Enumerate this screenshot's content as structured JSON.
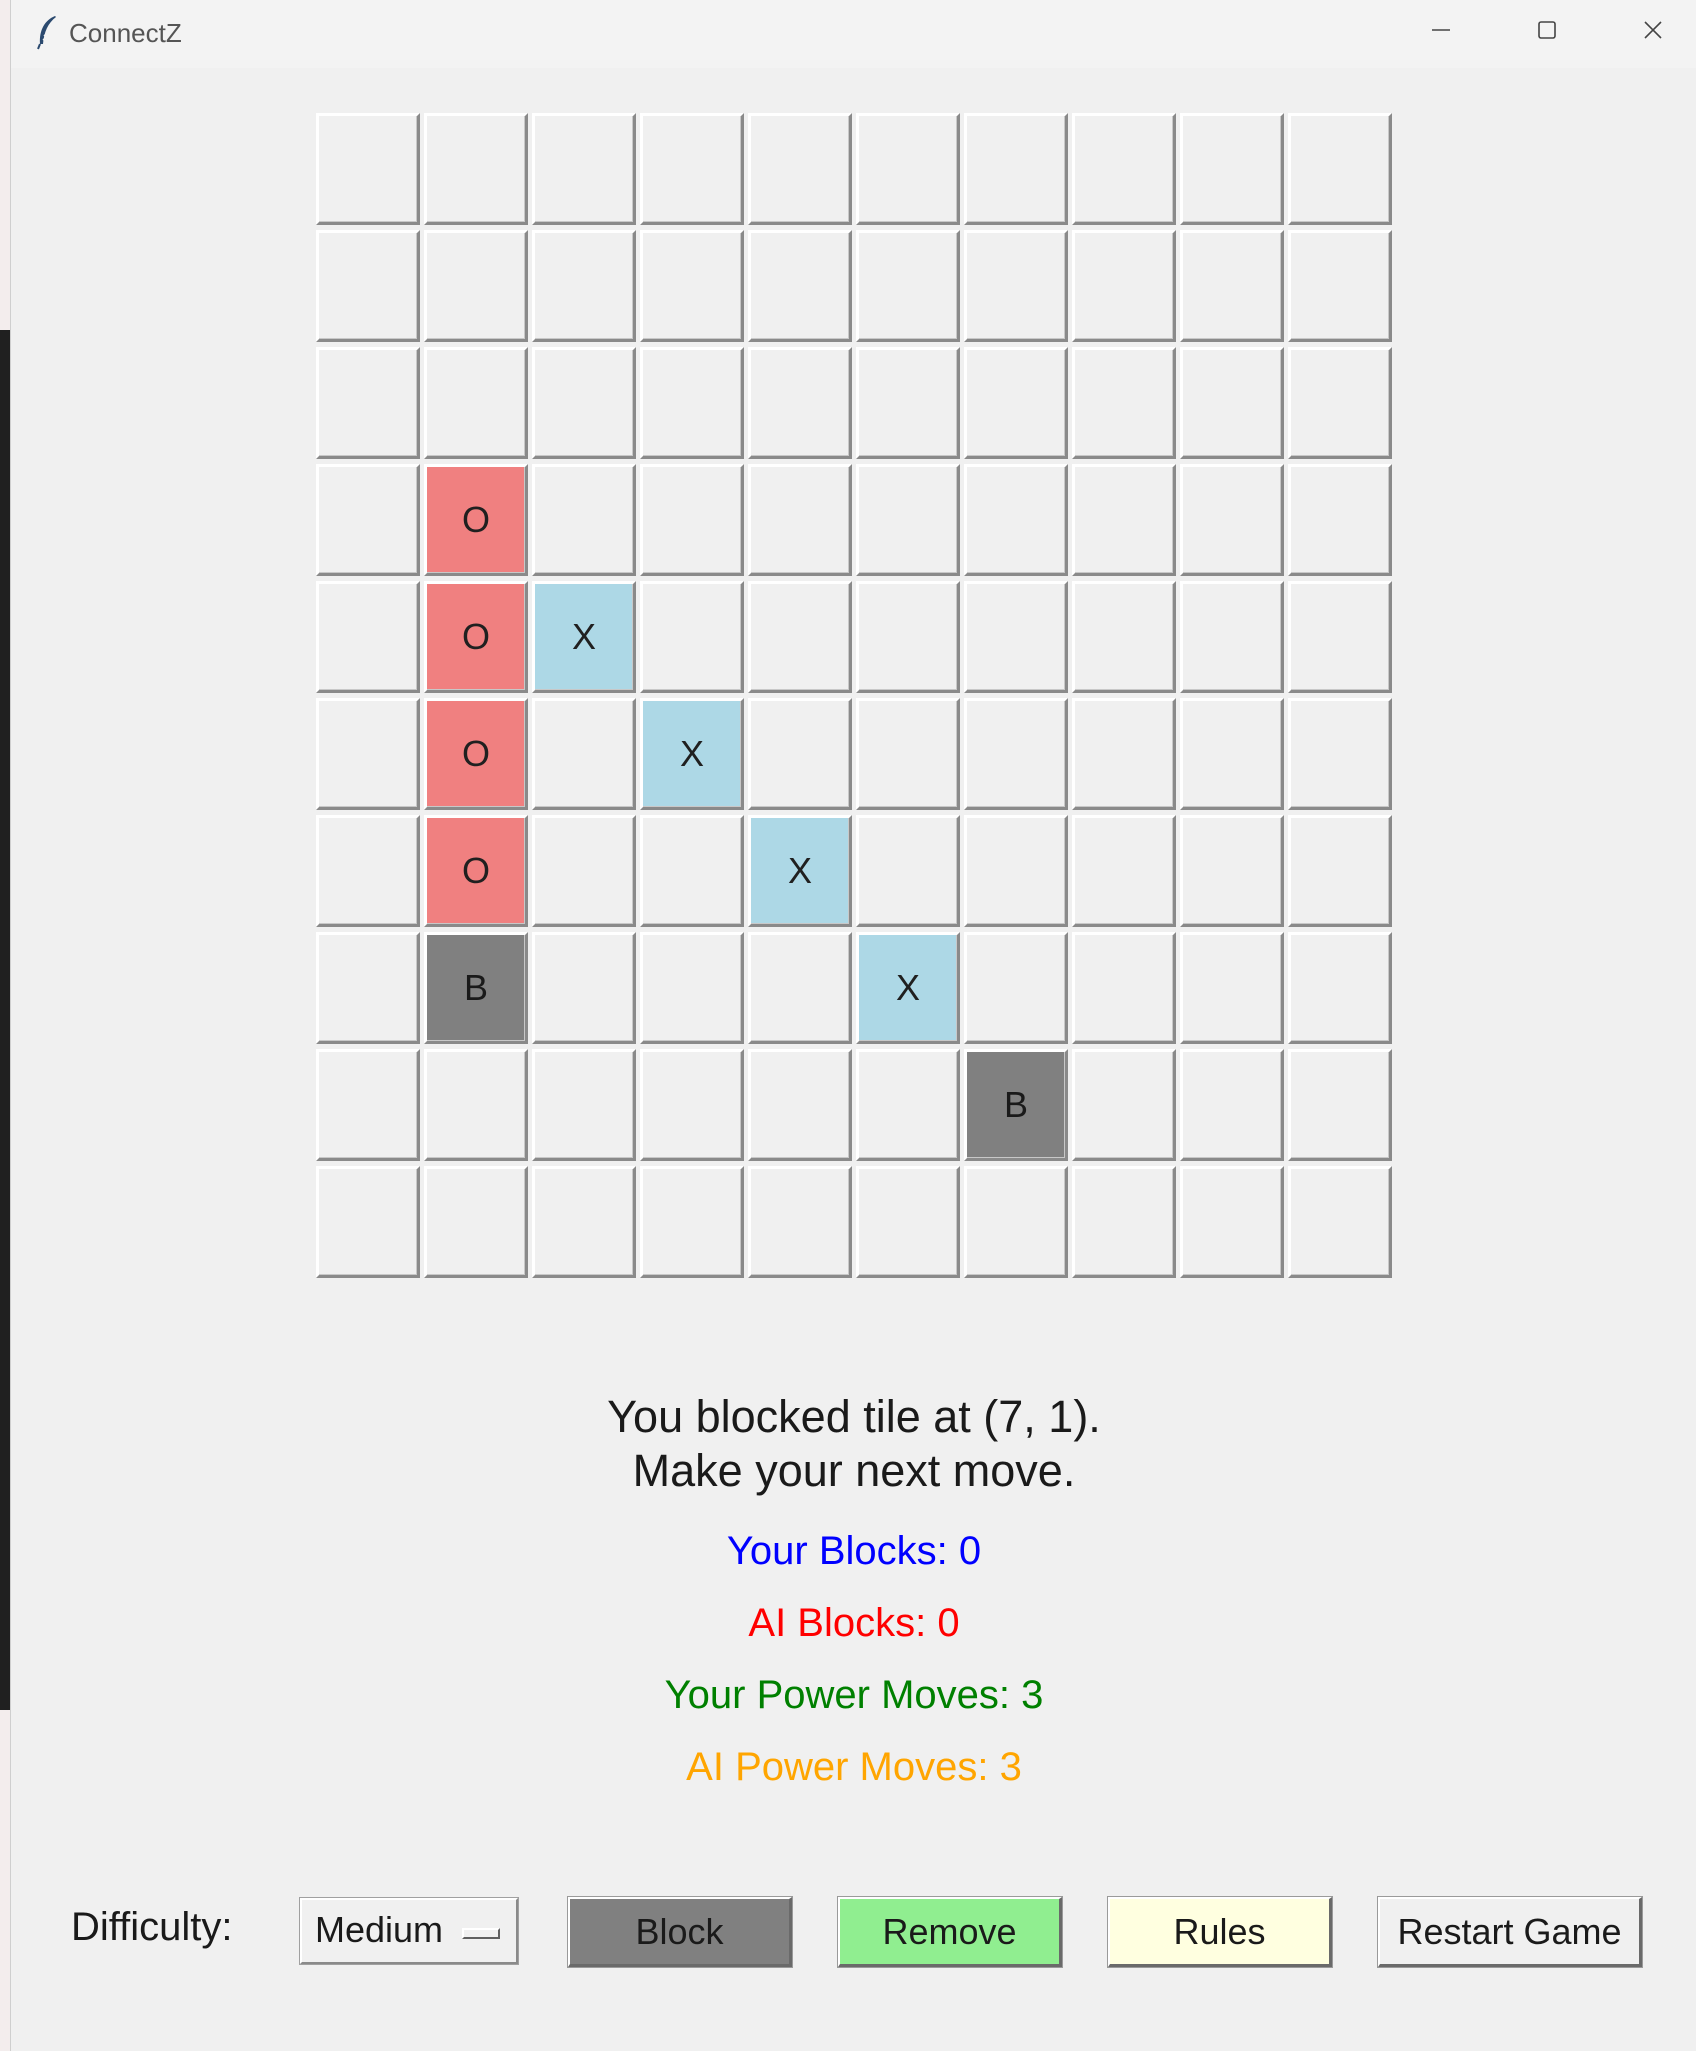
{
  "window": {
    "title": "ConnectZ",
    "icon": "feather-icon"
  },
  "board": {
    "rows": 10,
    "cols": 10,
    "cells": [
      [
        "",
        "",
        "",
        "",
        "",
        "",
        "",
        "",
        "",
        ""
      ],
      [
        "",
        "",
        "",
        "",
        "",
        "",
        "",
        "",
        "",
        ""
      ],
      [
        "",
        "",
        "",
        "",
        "",
        "",
        "",
        "",
        "",
        ""
      ],
      [
        "",
        "O",
        "",
        "",
        "",
        "",
        "",
        "",
        "",
        ""
      ],
      [
        "",
        "O",
        "X",
        "",
        "",
        "",
        "",
        "",
        "",
        ""
      ],
      [
        "",
        "O",
        "",
        "X",
        "",
        "",
        "",
        "",
        "",
        ""
      ],
      [
        "",
        "O",
        "",
        "",
        "X",
        "",
        "",
        "",
        "",
        ""
      ],
      [
        "",
        "B",
        "",
        "",
        "",
        "X",
        "",
        "",
        "",
        ""
      ],
      [
        "",
        "",
        "",
        "",
        "",
        "",
        "B",
        "",
        "",
        ""
      ],
      [
        "",
        "",
        "",
        "",
        "",
        "",
        "",
        "",
        "",
        ""
      ]
    ],
    "colors": {
      "O": "#f08080",
      "X": "#add8e6",
      "B": "#808080",
      "empty": "#f0f0f0"
    }
  },
  "status": {
    "line1": "You blocked tile at (7, 1).",
    "line2": "Make your next move."
  },
  "stats": {
    "your_blocks": "Your Blocks: 0",
    "ai_blocks": "AI Blocks: 0",
    "your_power_moves": "Your Power Moves: 3",
    "ai_power_moves": "AI Power Moves: 3",
    "colors": {
      "your_blocks": "#0000ff",
      "ai_blocks": "#ff0000",
      "your_power_moves": "#008000",
      "ai_power_moves": "#ffa500"
    }
  },
  "controls": {
    "difficulty_label": "Difficulty:",
    "difficulty_value": "Medium",
    "block_label": "Block",
    "remove_label": "Remove",
    "rules_label": "Rules",
    "restart_label": "Restart Game",
    "colors": {
      "block": "#808080",
      "remove": "#90ee90",
      "rules": "#ffffe0",
      "restart": "#f0f0f0"
    }
  }
}
